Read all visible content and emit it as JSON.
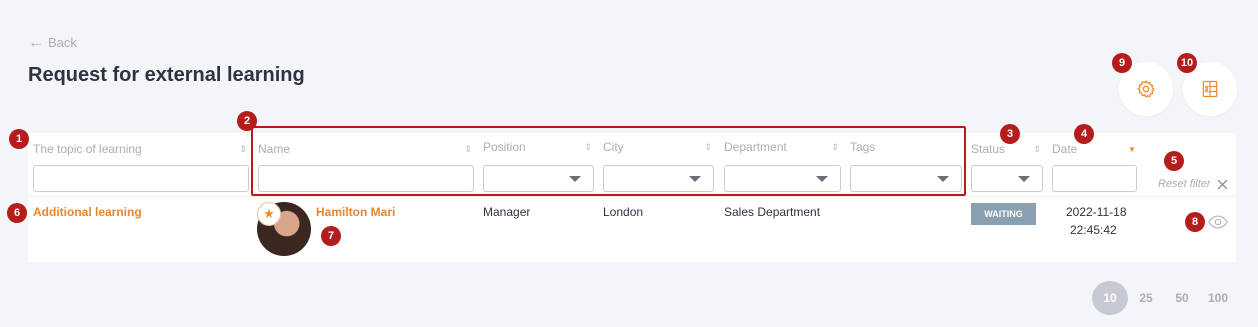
{
  "header": {
    "back_label": "Back",
    "title": "Request for external learning"
  },
  "columns": {
    "topic": "The topic of learning",
    "name": "Name",
    "position": "Position",
    "city": "City",
    "department": "Department",
    "tags": "Tags",
    "status": "Status",
    "date": "Date"
  },
  "filters": {
    "reset_label": "Reset filter"
  },
  "row": {
    "topic": "Additional learning",
    "name": "Hamilton Mari",
    "position": "Manager",
    "city": "London",
    "department": "Sales Department",
    "status": "WAITING",
    "date": "2022-11-18",
    "time": "22:45:42"
  },
  "pagination": {
    "options": [
      "10",
      "25",
      "50",
      "100"
    ],
    "selected": "10"
  },
  "markers": [
    "1",
    "2",
    "3",
    "4",
    "5",
    "6",
    "7",
    "8",
    "9",
    "10"
  ],
  "colors": {
    "accent": "#e8862a",
    "marker": "#b51c1c",
    "status_waiting": "#8aa0b0"
  }
}
